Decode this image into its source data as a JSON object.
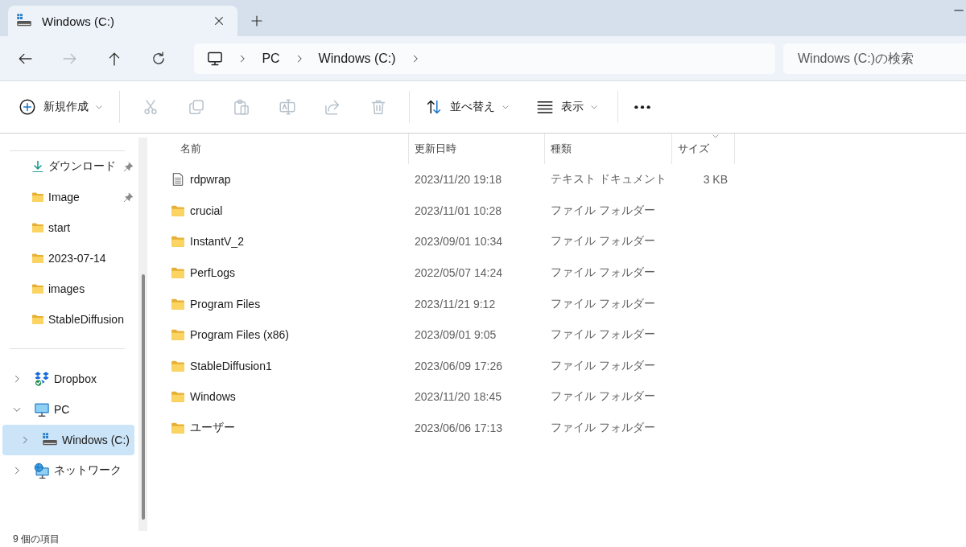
{
  "window": {
    "tab": {
      "title": "Windows (C:)"
    }
  },
  "nav": {
    "back": {
      "disabled": false
    },
    "forward": {
      "disabled": true
    },
    "up": {
      "disabled": false
    },
    "breadcrumb": [
      "PC",
      "Windows (C:)"
    ],
    "search": {
      "placeholder": "Windows (C:)の検索"
    }
  },
  "commands": {
    "new": {
      "label": "新規作成"
    },
    "actions": [
      {
        "disabled": true
      },
      {
        "disabled": true
      },
      {
        "disabled": true
      },
      {
        "disabled": true
      },
      {
        "disabled": true
      },
      {
        "disabled": true
      }
    ],
    "sort": {
      "label": "並べ替え"
    },
    "view": {
      "label": "表示"
    }
  },
  "sidebar": {
    "quick_access": [
      {
        "kind": "download",
        "label": "ダウンロード",
        "pinned": true
      },
      {
        "kind": "folder",
        "label": "Image",
        "pinned": true
      },
      {
        "kind": "folder",
        "label": "start",
        "pinned": false
      },
      {
        "kind": "folder",
        "label": "2023-07-14",
        "pinned": false
      },
      {
        "kind": "folder",
        "label": "images",
        "pinned": false
      },
      {
        "kind": "folder",
        "label": "StableDiffusion",
        "pinned": false
      }
    ],
    "tree": [
      {
        "kind": "cloud",
        "label": "Dropbox",
        "expanded": false,
        "selected": false
      },
      {
        "kind": "pc",
        "label": "PC",
        "expanded": true,
        "selected": false,
        "children": [
          {
            "kind": "drive",
            "label": "Windows (C:)",
            "expanded": false,
            "selected": true
          }
        ]
      },
      {
        "kind": "network",
        "label": "ネットワーク",
        "expanded": false,
        "selected": false
      }
    ]
  },
  "table": {
    "columns": [
      {
        "label": "名前",
        "sorted": false
      },
      {
        "label": "更新日時",
        "sorted": false
      },
      {
        "label": "種類",
        "sorted": false
      },
      {
        "label": "サイズ",
        "sorted": true
      }
    ],
    "rows": [
      {
        "kind": "document",
        "name": "rdpwrap",
        "modified": "2023/11/20 19:18",
        "type": "テキスト ドキュメント",
        "size": "3 KB"
      },
      {
        "kind": "folder",
        "name": "crucial",
        "modified": "2023/11/01 10:28",
        "type": "ファイル フォルダー"
      },
      {
        "kind": "folder",
        "name": "InstantV_2",
        "modified": "2023/09/01 10:34",
        "type": "ファイル フォルダー"
      },
      {
        "kind": "folder",
        "name": "PerfLogs",
        "modified": "2022/05/07 14:24",
        "type": "ファイル フォルダー"
      },
      {
        "kind": "folder",
        "name": "Program Files",
        "modified": "2023/11/21 9:12",
        "type": "ファイル フォルダー"
      },
      {
        "kind": "folder",
        "name": "Program Files (x86)",
        "modified": "2023/09/01 9:05",
        "type": "ファイル フォルダー"
      },
      {
        "kind": "folder",
        "name": "StableDiffusion1",
        "modified": "2023/06/09 17:26",
        "type": "ファイル フォルダー"
      },
      {
        "kind": "folder",
        "name": "Windows",
        "modified": "2023/11/20 18:45",
        "type": "ファイル フォルダー"
      },
      {
        "kind": "folder",
        "name": "ユーザー",
        "modified": "2023/06/06 17:13",
        "type": "ファイル フォルダー"
      }
    ]
  },
  "status_bar": {
    "item_count": "9 個の項目"
  }
}
